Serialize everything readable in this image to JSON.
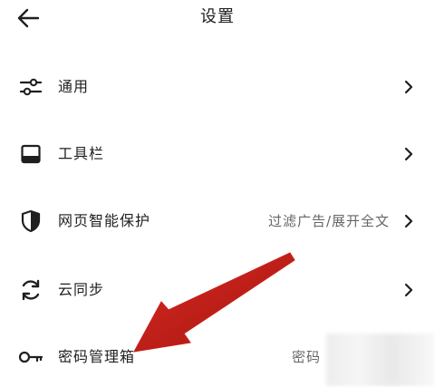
{
  "header": {
    "title": "设置",
    "back_icon": "arrow-left-icon"
  },
  "settings": {
    "items": [
      {
        "label": "通用",
        "value": "",
        "icon": "sliders-icon"
      },
      {
        "label": "工具栏",
        "value": "",
        "icon": "toolbar-icon"
      },
      {
        "label": "网页智能保护",
        "value": "过滤广告/展开全文",
        "icon": "shield-icon"
      },
      {
        "label": "云同步",
        "value": "",
        "icon": "sync-icon"
      },
      {
        "label": "密码管理箱",
        "value": "密码",
        "icon": "key-icon"
      }
    ]
  },
  "annotation": {
    "arrow_color": "#c8201c"
  }
}
